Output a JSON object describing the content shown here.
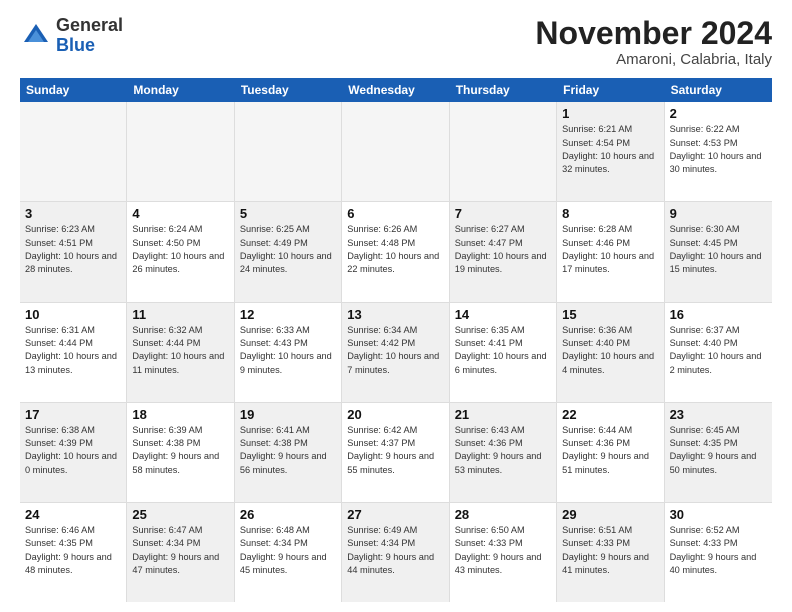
{
  "logo": {
    "general": "General",
    "blue": "Blue"
  },
  "header": {
    "month": "November 2024",
    "location": "Amaroni, Calabria, Italy"
  },
  "days_of_week": [
    "Sunday",
    "Monday",
    "Tuesday",
    "Wednesday",
    "Thursday",
    "Friday",
    "Saturday"
  ],
  "weeks": [
    [
      {
        "day": "",
        "info": "",
        "empty": true
      },
      {
        "day": "",
        "info": "",
        "empty": true
      },
      {
        "day": "",
        "info": "",
        "empty": true
      },
      {
        "day": "",
        "info": "",
        "empty": true
      },
      {
        "day": "",
        "info": "",
        "empty": true
      },
      {
        "day": "1",
        "info": "Sunrise: 6:21 AM\nSunset: 4:54 PM\nDaylight: 10 hours and 32 minutes.",
        "shaded": true
      },
      {
        "day": "2",
        "info": "Sunrise: 6:22 AM\nSunset: 4:53 PM\nDaylight: 10 hours and 30 minutes.",
        "shaded": false
      }
    ],
    [
      {
        "day": "3",
        "info": "Sunrise: 6:23 AM\nSunset: 4:51 PM\nDaylight: 10 hours and 28 minutes.",
        "shaded": true
      },
      {
        "day": "4",
        "info": "Sunrise: 6:24 AM\nSunset: 4:50 PM\nDaylight: 10 hours and 26 minutes.",
        "shaded": false
      },
      {
        "day": "5",
        "info": "Sunrise: 6:25 AM\nSunset: 4:49 PM\nDaylight: 10 hours and 24 minutes.",
        "shaded": true
      },
      {
        "day": "6",
        "info": "Sunrise: 6:26 AM\nSunset: 4:48 PM\nDaylight: 10 hours and 22 minutes.",
        "shaded": false
      },
      {
        "day": "7",
        "info": "Sunrise: 6:27 AM\nSunset: 4:47 PM\nDaylight: 10 hours and 19 minutes.",
        "shaded": true
      },
      {
        "day": "8",
        "info": "Sunrise: 6:28 AM\nSunset: 4:46 PM\nDaylight: 10 hours and 17 minutes.",
        "shaded": false
      },
      {
        "day": "9",
        "info": "Sunrise: 6:30 AM\nSunset: 4:45 PM\nDaylight: 10 hours and 15 minutes.",
        "shaded": true
      }
    ],
    [
      {
        "day": "10",
        "info": "Sunrise: 6:31 AM\nSunset: 4:44 PM\nDaylight: 10 hours and 13 minutes.",
        "shaded": false
      },
      {
        "day": "11",
        "info": "Sunrise: 6:32 AM\nSunset: 4:44 PM\nDaylight: 10 hours and 11 minutes.",
        "shaded": true
      },
      {
        "day": "12",
        "info": "Sunrise: 6:33 AM\nSunset: 4:43 PM\nDaylight: 10 hours and 9 minutes.",
        "shaded": false
      },
      {
        "day": "13",
        "info": "Sunrise: 6:34 AM\nSunset: 4:42 PM\nDaylight: 10 hours and 7 minutes.",
        "shaded": true
      },
      {
        "day": "14",
        "info": "Sunrise: 6:35 AM\nSunset: 4:41 PM\nDaylight: 10 hours and 6 minutes.",
        "shaded": false
      },
      {
        "day": "15",
        "info": "Sunrise: 6:36 AM\nSunset: 4:40 PM\nDaylight: 10 hours and 4 minutes.",
        "shaded": true
      },
      {
        "day": "16",
        "info": "Sunrise: 6:37 AM\nSunset: 4:40 PM\nDaylight: 10 hours and 2 minutes.",
        "shaded": false
      }
    ],
    [
      {
        "day": "17",
        "info": "Sunrise: 6:38 AM\nSunset: 4:39 PM\nDaylight: 10 hours and 0 minutes.",
        "shaded": true
      },
      {
        "day": "18",
        "info": "Sunrise: 6:39 AM\nSunset: 4:38 PM\nDaylight: 9 hours and 58 minutes.",
        "shaded": false
      },
      {
        "day": "19",
        "info": "Sunrise: 6:41 AM\nSunset: 4:38 PM\nDaylight: 9 hours and 56 minutes.",
        "shaded": true
      },
      {
        "day": "20",
        "info": "Sunrise: 6:42 AM\nSunset: 4:37 PM\nDaylight: 9 hours and 55 minutes.",
        "shaded": false
      },
      {
        "day": "21",
        "info": "Sunrise: 6:43 AM\nSunset: 4:36 PM\nDaylight: 9 hours and 53 minutes.",
        "shaded": true
      },
      {
        "day": "22",
        "info": "Sunrise: 6:44 AM\nSunset: 4:36 PM\nDaylight: 9 hours and 51 minutes.",
        "shaded": false
      },
      {
        "day": "23",
        "info": "Sunrise: 6:45 AM\nSunset: 4:35 PM\nDaylight: 9 hours and 50 minutes.",
        "shaded": true
      }
    ],
    [
      {
        "day": "24",
        "info": "Sunrise: 6:46 AM\nSunset: 4:35 PM\nDaylight: 9 hours and 48 minutes.",
        "shaded": false
      },
      {
        "day": "25",
        "info": "Sunrise: 6:47 AM\nSunset: 4:34 PM\nDaylight: 9 hours and 47 minutes.",
        "shaded": true
      },
      {
        "day": "26",
        "info": "Sunrise: 6:48 AM\nSunset: 4:34 PM\nDaylight: 9 hours and 45 minutes.",
        "shaded": false
      },
      {
        "day": "27",
        "info": "Sunrise: 6:49 AM\nSunset: 4:34 PM\nDaylight: 9 hours and 44 minutes.",
        "shaded": true
      },
      {
        "day": "28",
        "info": "Sunrise: 6:50 AM\nSunset: 4:33 PM\nDaylight: 9 hours and 43 minutes.",
        "shaded": false
      },
      {
        "day": "29",
        "info": "Sunrise: 6:51 AM\nSunset: 4:33 PM\nDaylight: 9 hours and 41 minutes.",
        "shaded": true
      },
      {
        "day": "30",
        "info": "Sunrise: 6:52 AM\nSunset: 4:33 PM\nDaylight: 9 hours and 40 minutes.",
        "shaded": false
      }
    ]
  ]
}
